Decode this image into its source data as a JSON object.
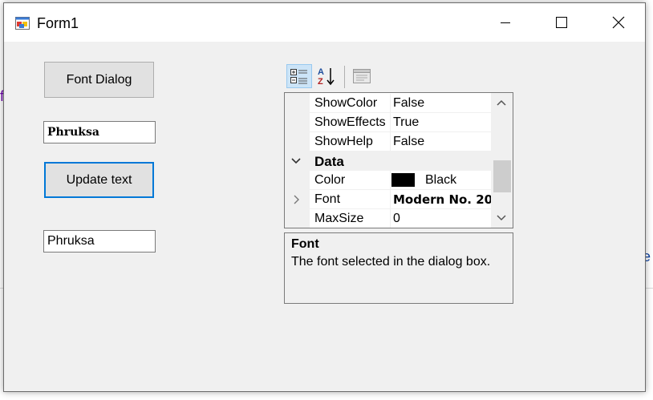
{
  "window": {
    "title": "Form1"
  },
  "form": {
    "font_dialog_button": "Font Dialog",
    "textbox_top_value": "Phruksa",
    "update_button": "Update text",
    "textbox_bottom_value": "Phruksa"
  },
  "property_grid": {
    "rows": [
      {
        "name": "ShowColor",
        "value": "False"
      },
      {
        "name": "ShowEffects",
        "value": "True"
      },
      {
        "name": "ShowHelp",
        "value": "False"
      }
    ],
    "category": {
      "name": "Data",
      "expanded": true
    },
    "color_row": {
      "name": "Color",
      "value": "Black",
      "swatch": "#000000"
    },
    "font_row": {
      "name": "Font",
      "value": "Modern No. 20"
    },
    "maxsize_row": {
      "name": "MaxSize",
      "value": "0"
    },
    "description": {
      "title": "Font",
      "text": "The font selected in the dialog box."
    }
  },
  "colors": {
    "accent": "#0078d7",
    "form_bg": "#f0f0f0",
    "title_bg": "#ffffff"
  },
  "icons": [
    "app-icon",
    "minimize-icon",
    "maximize-icon",
    "close-icon",
    "categorized-icon",
    "alphabetical-icon",
    "property-pages-icon",
    "chevron-down-icon",
    "chevron-right-icon",
    "scroll-up-icon",
    "scroll-down-icon"
  ]
}
